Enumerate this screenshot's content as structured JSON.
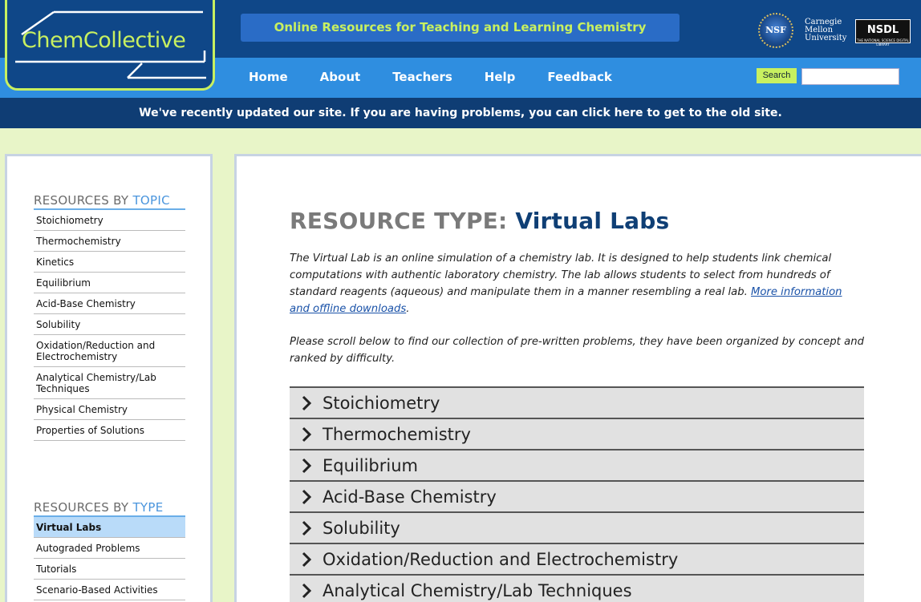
{
  "header": {
    "logo_text": "ChemCollective",
    "tagline": "Online Resources for Teaching and Learning Chemistry",
    "sponsors": {
      "nsf": "NSF",
      "cmu": [
        "Carnegie",
        "Mellon",
        "University"
      ],
      "nsdl": "NSDL",
      "nsdl_sub": "THE NATIONAL SCIENCE DIGITAL LIBRARY"
    },
    "nav": [
      "Home",
      "About",
      "Teachers",
      "Help",
      "Feedback"
    ],
    "search": {
      "button_label": "Search",
      "value": ""
    },
    "notice": "We've recently updated our site. If you are having problems, you can click here to get to the old site."
  },
  "sidebar": {
    "topic_heading": {
      "prefix": "RESOURCES BY",
      "accent": "TOPIC"
    },
    "topic_items": [
      "Stoichiometry",
      "Thermochemistry",
      "Kinetics",
      "Equilibrium",
      "Acid-Base Chemistry",
      "Solubility",
      "Oxidation/Reduction and Electrochemistry",
      "Analytical Chemistry/Lab Techniques",
      "Physical Chemistry",
      "Properties of Solutions"
    ],
    "type_heading": {
      "prefix": "RESOURCES BY",
      "accent": "TYPE"
    },
    "type_items": [
      "Virtual Labs",
      "Autograded Problems",
      "Tutorials",
      "Scenario-Based Activities"
    ],
    "active_type": "Virtual Labs"
  },
  "main": {
    "title_prefix": "RESOURCE TYPE:",
    "title_value": "Virtual Labs",
    "intro_text": "The Virtual Lab is an online simulation of a chemistry lab. It is designed to help students link chemical computations with authentic laboratory chemistry. The lab allows students to select from hundreds of standard reagents (aqueous) and manipulate them in a manner resembling a real lab. ",
    "intro_link": "More information and offline downloads",
    "intro_end": ".",
    "scroll_text": "Please scroll below to find our collection of pre-written problems, they have been organized by concept and ranked by difficulty.",
    "categories": [
      "Stoichiometry",
      "Thermochemistry",
      "Equilibrium",
      "Acid-Base Chemistry",
      "Solubility",
      "Oxidation/Reduction and Electrochemistry",
      "Analytical Chemistry/Lab Techniques"
    ]
  },
  "colors": {
    "header_dark": "#0f4788",
    "nav_blue": "#2f8ee0",
    "notice_bar": "#0f3d74",
    "lime_accent": "#c8f060",
    "page_bg": "#e8f5c8",
    "title_blue": "#0f3f75",
    "sidebar_active": "#b9dbf9"
  }
}
